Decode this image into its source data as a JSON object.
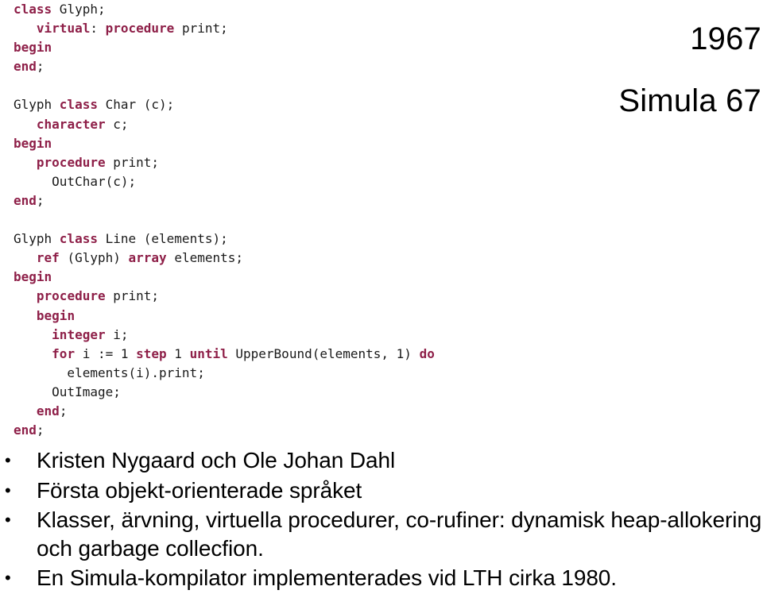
{
  "headings": {
    "year": "1967",
    "language": "Simula 67"
  },
  "code": {
    "keyword_color": "#8E1F48",
    "text_color": "#1A1A1A",
    "blocks": [
      {
        "name": "glyph-class",
        "lines": [
          [
            {
              "t": "class",
              "k": true
            },
            {
              "t": " Glyph;",
              "k": false
            }
          ],
          [
            {
              "t": "   ",
              "k": false
            },
            {
              "t": "virtual",
              "k": true
            },
            {
              "t": ": ",
              "k": false
            },
            {
              "t": "procedure",
              "k": true
            },
            {
              "t": " print;",
              "k": false
            }
          ],
          [
            {
              "t": "begin",
              "k": true
            }
          ],
          [
            {
              "t": "end",
              "k": true
            },
            {
              "t": ";",
              "k": false
            }
          ],
          []
        ]
      },
      {
        "name": "char-class",
        "lines": [
          [
            {
              "t": "Glyph ",
              "k": false
            },
            {
              "t": "class",
              "k": true
            },
            {
              "t": " Char (c);",
              "k": false
            }
          ],
          [
            {
              "t": "   ",
              "k": false
            },
            {
              "t": "character",
              "k": true
            },
            {
              "t": " c;",
              "k": false
            }
          ],
          [
            {
              "t": "begin",
              "k": true
            }
          ],
          [
            {
              "t": "   ",
              "k": false
            },
            {
              "t": "procedure",
              "k": true
            },
            {
              "t": " print;",
              "k": false
            }
          ],
          [
            {
              "t": "     OutChar(c);",
              "k": false
            }
          ],
          [
            {
              "t": "end",
              "k": true
            },
            {
              "t": ";",
              "k": false
            }
          ],
          []
        ]
      },
      {
        "name": "line-class",
        "lines": [
          [
            {
              "t": "Glyph ",
              "k": false
            },
            {
              "t": "class",
              "k": true
            },
            {
              "t": " Line (elements);",
              "k": false
            }
          ],
          [
            {
              "t": "   ",
              "k": false
            },
            {
              "t": "ref",
              "k": true
            },
            {
              "t": " (Glyph) ",
              "k": false
            },
            {
              "t": "array",
              "k": true
            },
            {
              "t": " elements;",
              "k": false
            }
          ],
          [
            {
              "t": "begin",
              "k": true
            }
          ],
          [
            {
              "t": "   ",
              "k": false
            },
            {
              "t": "procedure",
              "k": true
            },
            {
              "t": " print;",
              "k": false
            }
          ],
          [
            {
              "t": "   ",
              "k": false
            },
            {
              "t": "begin",
              "k": true
            }
          ],
          [
            {
              "t": "     ",
              "k": false
            },
            {
              "t": "integer",
              "k": true
            },
            {
              "t": " i;",
              "k": false
            }
          ],
          [
            {
              "t": "     ",
              "k": false
            },
            {
              "t": "for",
              "k": true
            },
            {
              "t": " i := 1 ",
              "k": false
            },
            {
              "t": "step",
              "k": true
            },
            {
              "t": " 1 ",
              "k": false
            },
            {
              "t": "until",
              "k": true
            },
            {
              "t": " UpperBound(elements, 1) ",
              "k": false
            },
            {
              "t": "do",
              "k": true
            }
          ],
          [
            {
              "t": "       elements(i).print;",
              "k": false
            }
          ],
          [
            {
              "t": "     OutImage;",
              "k": false
            }
          ],
          [
            {
              "t": "   ",
              "k": false
            },
            {
              "t": "end",
              "k": true
            },
            {
              "t": ";",
              "k": false
            }
          ],
          [
            {
              "t": "end",
              "k": true
            },
            {
              "t": ";",
              "k": false
            }
          ]
        ]
      }
    ]
  },
  "bullets": {
    "marker": "•",
    "items": [
      "Kristen Nygaard och Ole Johan Dahl",
      "Första objekt-orienterade språket",
      "Klasser, ärvning, virtuella procedurer, co-ruﬁner: dynamisk heap-allokering och garbage collecﬁon.",
      "En Simula-kompilator implementerades vid LTH cirka 1980."
    ]
  }
}
